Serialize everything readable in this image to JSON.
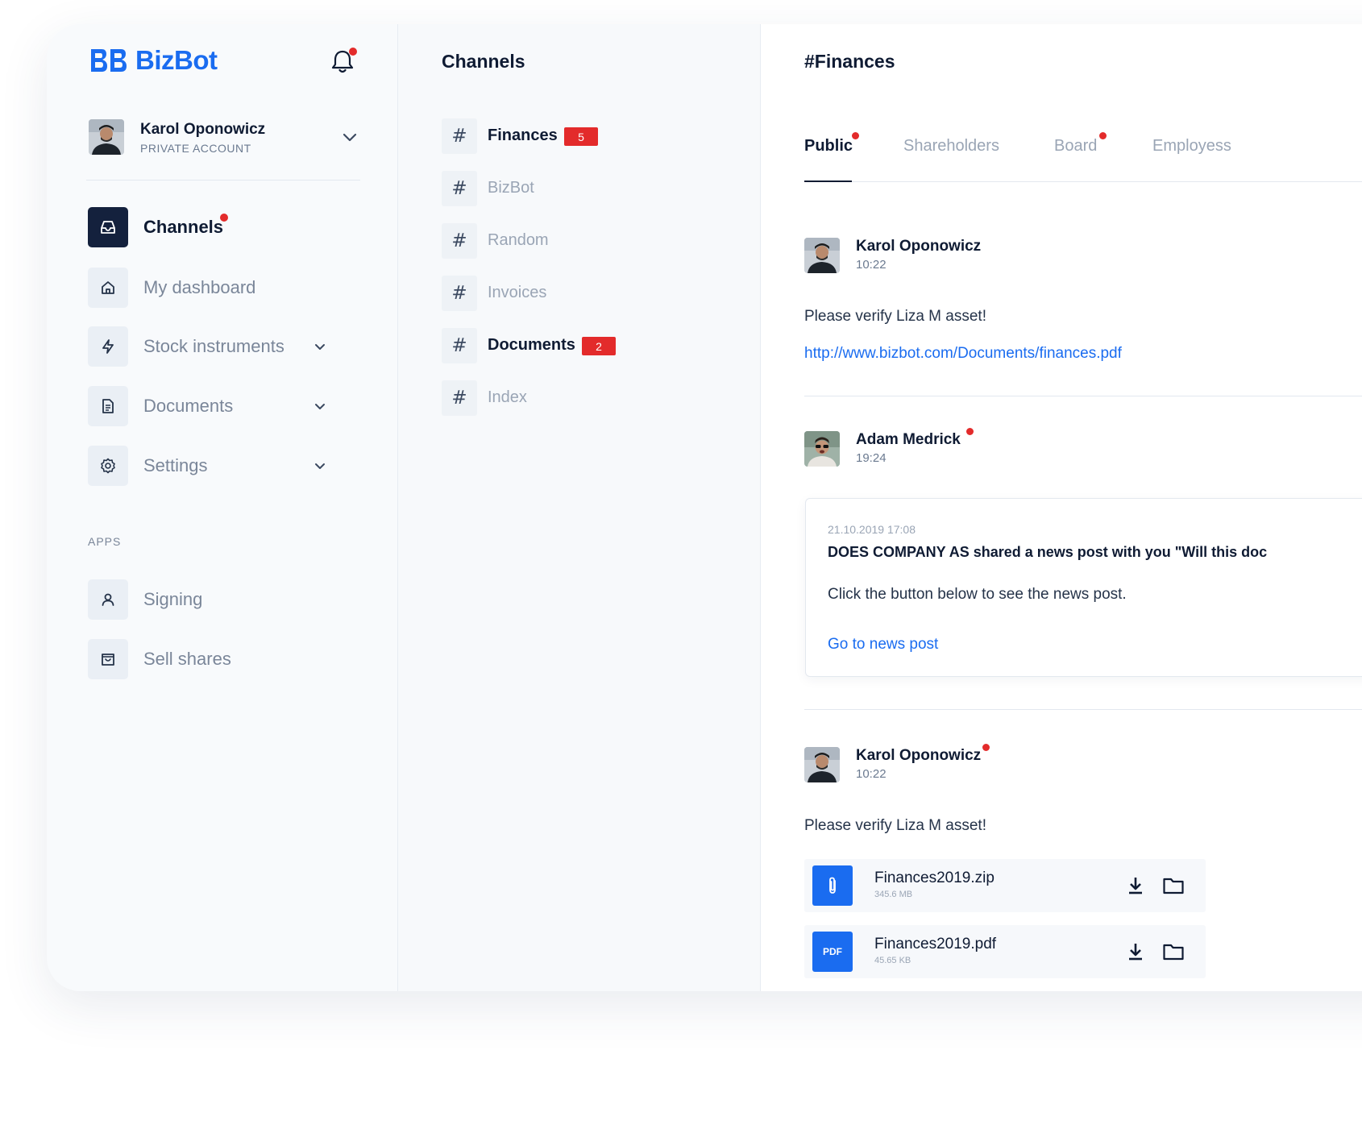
{
  "brand": {
    "name": "BizBot",
    "accent": "#1a6cf0",
    "badge_color": "#e32b2b",
    "active_nav_color": "#14213d"
  },
  "account": {
    "name": "Karol Oponowicz",
    "type": "PRIVATE ACCOUNT"
  },
  "nav": {
    "items": [
      {
        "label": "Channels",
        "icon": "inbox-icon",
        "active": true,
        "has_dot": true
      },
      {
        "label": "My dashboard",
        "icon": "home-icon",
        "active": false
      },
      {
        "label": "Stock instruments",
        "icon": "lightning-icon",
        "active": false,
        "has_chevron": true
      },
      {
        "label": "Documents",
        "icon": "document-icon",
        "active": false,
        "has_chevron": true
      },
      {
        "label": "Settings",
        "icon": "gear-icon",
        "active": false,
        "has_chevron": true
      }
    ],
    "apps_label": "APPS",
    "apps": [
      {
        "label": "Signing",
        "icon": "user-icon"
      },
      {
        "label": "Sell shares",
        "icon": "bag-icon"
      }
    ]
  },
  "channels": {
    "title": "Channels",
    "hash": "#",
    "items": [
      {
        "name": "Finances",
        "badge": "5",
        "bold": true
      },
      {
        "name": "BizBot"
      },
      {
        "name": "Random"
      },
      {
        "name": "Invoices"
      },
      {
        "name": "Documents",
        "badge": "2",
        "bold": true
      },
      {
        "name": "Index"
      }
    ]
  },
  "chat": {
    "title": "#Finances",
    "tabs": [
      {
        "label": "Public",
        "active": true,
        "has_dot": true
      },
      {
        "label": "Shareholders"
      },
      {
        "label": "Board",
        "has_dot": true
      },
      {
        "label": "Employess"
      }
    ],
    "messages": [
      {
        "author": "Karol Oponowicz",
        "time": "10:22",
        "text": "Please verify Liza M asset!",
        "link": "http://www.bizbot.com/Documents/finances.pdf"
      },
      {
        "author": "Adam Medrick",
        "time": "19:24",
        "card": {
          "date": "21.10.2019 17:08",
          "title": "DOES COMPANY AS shared a news post with you \"Will this doc",
          "body": "Click the button below to see the news post.",
          "link": "Go to news post"
        }
      },
      {
        "author": "Karol Oponowicz",
        "time": "10:22",
        "text": "Please verify Liza M asset!",
        "files": [
          {
            "name": "Finances2019.zip",
            "size": "345.6 MB",
            "icon": "paperclip-icon"
          },
          {
            "name": "Finances2019.pdf",
            "size": "45.65 KB",
            "icon": "pdf-icon",
            "icon_label": "PDF"
          }
        ]
      }
    ]
  }
}
